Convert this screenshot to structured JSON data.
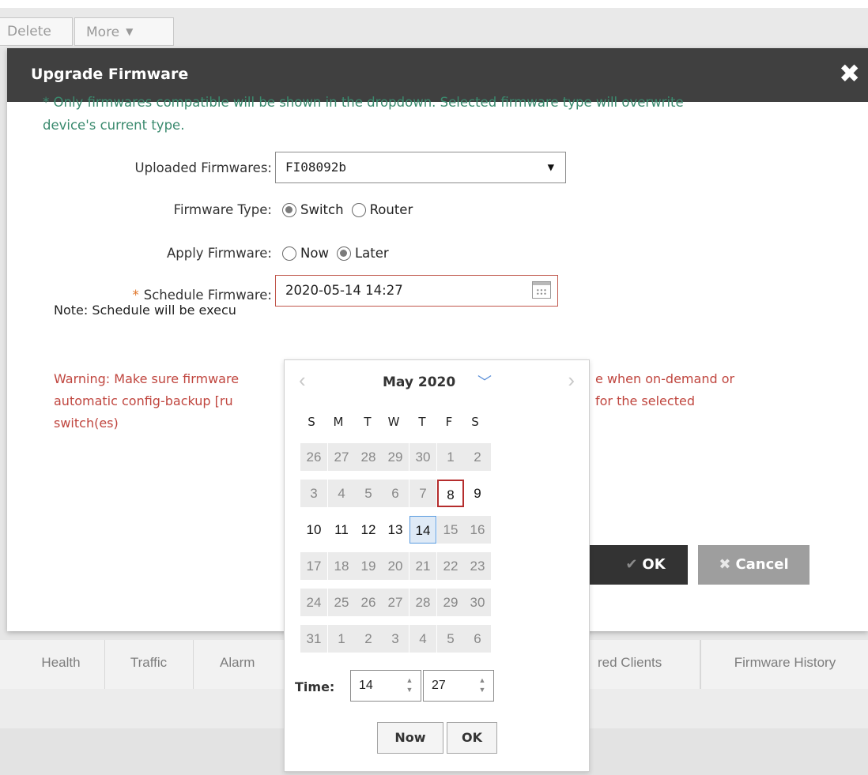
{
  "toolbar": {
    "delete_label": "Delete",
    "more_label": "More"
  },
  "dialog": {
    "title": "Upgrade Firmware",
    "close_glyph": "✖",
    "info_line1": "* Only firmwares compatible will be shown in the dropdown. Selected firmware type will overwrite",
    "info_line2": "device's current type.",
    "uploaded_firmwares_label": "Uploaded Firmwares:",
    "uploaded_firmwares_value": "FI08092b",
    "firmware_type_label": "Firmware Type:",
    "firmware_type_options": [
      "Switch",
      "Router"
    ],
    "firmware_type_selected": "Switch",
    "apply_firmware_label": "Apply Firmware:",
    "apply_firmware_options": [
      "Now",
      "Later"
    ],
    "apply_firmware_selected": "Later",
    "schedule_required_mark": "*",
    "schedule_label": "Schedule Firmware:",
    "schedule_value": "2020-05-14 14:27",
    "note_text": "Note: Schedule will be execu",
    "warning_line1": "Warning: Make sure firmware",
    "warning_line1_right": "e when on-demand or",
    "warning_line2": "automatic config-backup [ru",
    "warning_line2_right": "for the selected",
    "warning_line3": "switch(es)",
    "ok_label": "OK",
    "cancel_label": "Cancel"
  },
  "calendar": {
    "month_label": "May 2020",
    "prev_glyph": "‹",
    "next_glyph": "›",
    "dropdown_glyph": "﹀",
    "weekdays": [
      "S",
      "M",
      "T",
      "W",
      "T",
      "F",
      "S"
    ],
    "weeks": [
      [
        "26",
        "27",
        "28",
        "29",
        "30",
        "1",
        "2"
      ],
      [
        "3",
        "4",
        "5",
        "6",
        "7",
        "8",
        "9"
      ],
      [
        "10",
        "11",
        "12",
        "13",
        "14",
        "15",
        "16"
      ],
      [
        "17",
        "18",
        "19",
        "20",
        "21",
        "22",
        "23"
      ],
      [
        "24",
        "25",
        "26",
        "27",
        "28",
        "29",
        "30"
      ],
      [
        "31",
        "1",
        "2",
        "3",
        "4",
        "5",
        "6"
      ]
    ],
    "today": "8",
    "selected": "14",
    "time_label": "Time:",
    "hour": "14",
    "minute": "27",
    "now_label": "Now",
    "ok_label": "OK",
    "colors": {
      "today_border": "#b52d2d",
      "selected_border": "#5a9be0",
      "selected_bg": "#dfeaf6"
    }
  },
  "tabs": [
    "Health",
    "Traffic",
    "Alarm",
    "red Clients",
    "Firmware History"
  ]
}
